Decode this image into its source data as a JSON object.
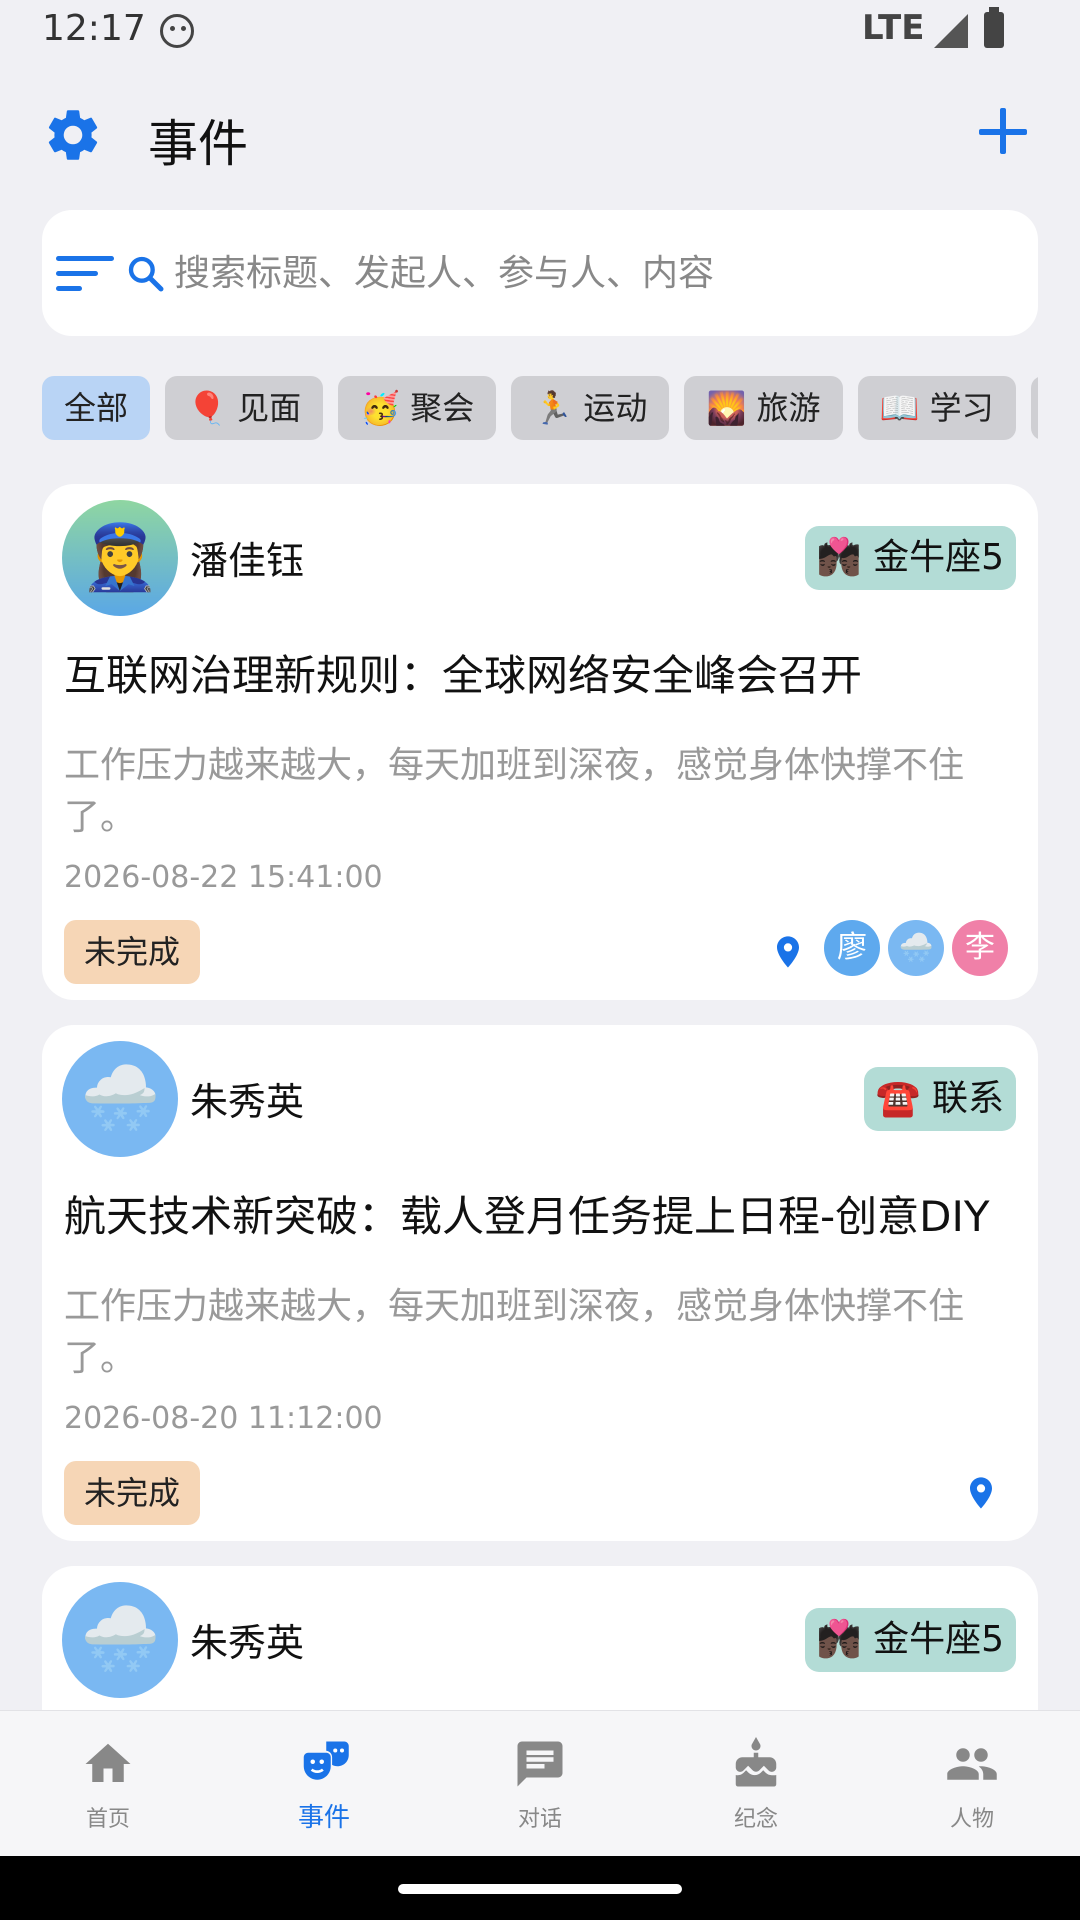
{
  "status_bar": {
    "time": "12:17",
    "network": "LTE"
  },
  "header": {
    "title": "事件"
  },
  "search": {
    "placeholder": "搜索标题、发起人、参与人、内容"
  },
  "chips": [
    {
      "label": "全部",
      "active": true
    },
    {
      "label": "🎈 见面"
    },
    {
      "label": "🥳 聚会"
    },
    {
      "label": "🏃 运动"
    },
    {
      "label": "🌄 旅游"
    },
    {
      "label": "📖 学习"
    },
    {
      "label": "💼"
    }
  ],
  "events": [
    {
      "avatar": "👮‍♀️",
      "author": "潘佳钰",
      "tag": "💏🏿 金牛座5",
      "title": "互联网治理新规则：全球网络安全峰会召开",
      "content": "工作压力越来越大，每天加班到深夜，感觉身体快撑不住了。",
      "date": "2026-08-22 15:41:00",
      "status": "未完成",
      "participants": [
        "廖",
        "🌨️",
        "李"
      ]
    },
    {
      "avatar": "🌨️",
      "author": "朱秀英",
      "tag": "☎️ 联系",
      "title": "航天技术新突破：载人登月任务提上日程-创意DIY",
      "content": "工作压力越来越大，每天加班到深夜，感觉身体快撑不住了。",
      "date": "2026-08-20 11:12:00",
      "status": "未完成",
      "participants": []
    },
    {
      "avatar": "🌨️",
      "author": "朱秀英",
      "tag": "💏🏿 金牛座5"
    }
  ],
  "bottom_nav": [
    {
      "label": "首页",
      "icon": "home-icon"
    },
    {
      "label": "事件",
      "icon": "events-icon",
      "active": true
    },
    {
      "label": "对话",
      "icon": "chat-icon"
    },
    {
      "label": "纪念",
      "icon": "cake-icon"
    },
    {
      "label": "人物",
      "icon": "people-icon"
    }
  ],
  "colors": {
    "accent": "#1a73e8",
    "tag": "#b3dcd6",
    "status": "#f6d6b6",
    "chip_active": "#b9d4f5"
  }
}
